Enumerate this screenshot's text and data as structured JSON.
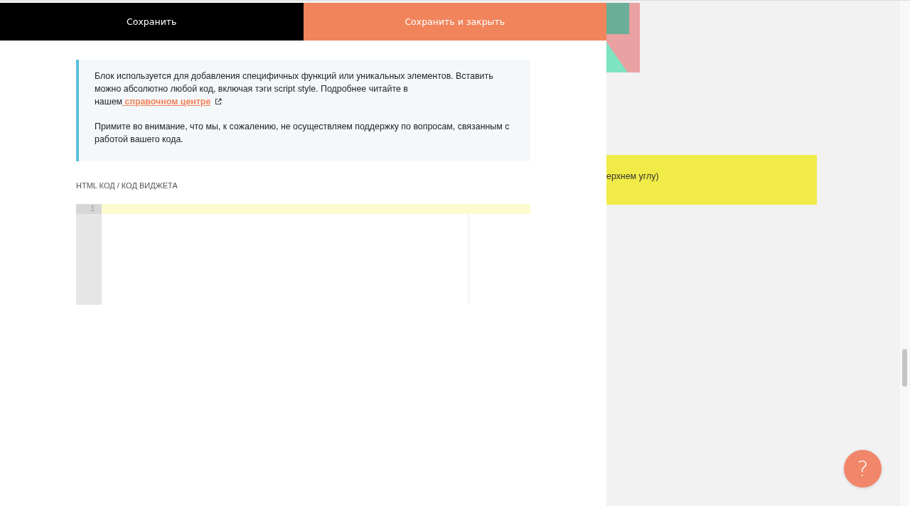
{
  "toolbar": {
    "buttons": [
      {
        "label": "Сохранить",
        "kind": "secondary"
      },
      {
        "label": "Сохранить и закрыть",
        "kind": "primary"
      }
    ]
  },
  "info": {
    "paragraphs": [
      {
        "text": "Блок используется для добавления специфичных функций или уникальных элементов. Вставить можно абсолютно любой код, включая тэги script style. Подробнее читайте в нашем",
        "link": " справочном центре"
      },
      {
        "text": "Примите во внимание, что мы, к сожалению, не осуществляем поддержку по вопросам, связанным с работой вашего кода."
      }
    ]
  },
  "editor": {
    "label": "HTML КОД / КОД ВИДЖЕТА",
    "line_numbers": [
      "1"
    ]
  },
  "background": {
    "banner_text": "ерхнем углу)"
  },
  "help_button": {
    "label": "?"
  }
}
